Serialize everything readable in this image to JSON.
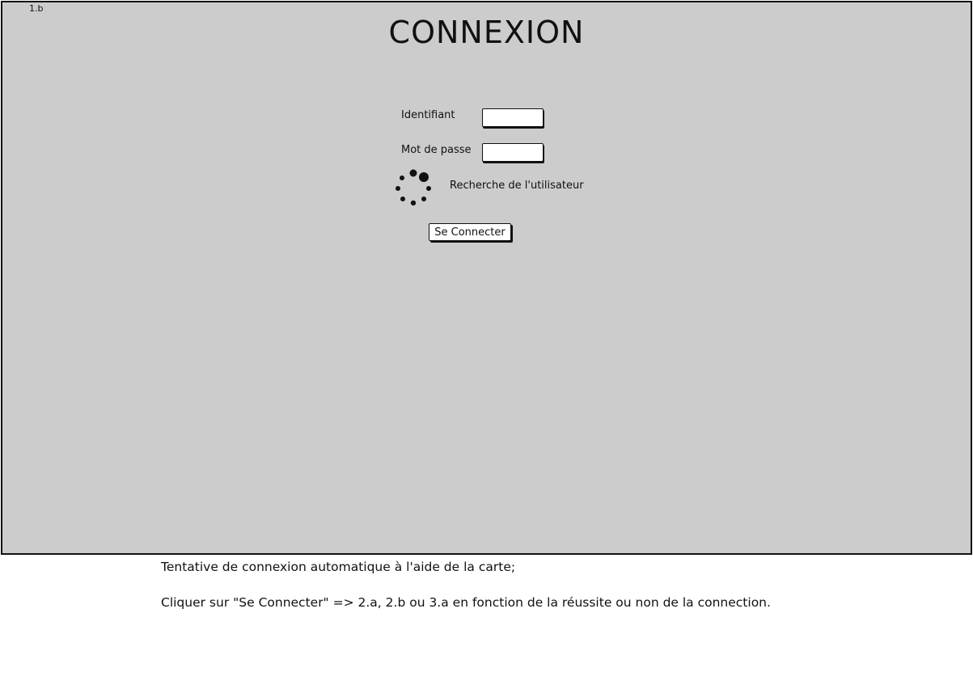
{
  "screen_id": "1.b",
  "title": "CONNEXION",
  "form": {
    "username_label": "Identifiant",
    "username_value": "",
    "password_label": "Mot de passe",
    "password_value": "",
    "status_text": "Recherche de l'utilisateur",
    "status_icon": "loading-spinner-icon",
    "submit_label": "Se Connecter"
  },
  "notes": [
    "Tentative de connexion automatique à l'aide de la carte;",
    "Cliquer sur \"Se Connecter\" => 2.a, 2.b ou 3.a en fonction de la réussite ou non de la connection."
  ],
  "colors": {
    "frame_background": "#cccccc",
    "outline": "#111111"
  }
}
